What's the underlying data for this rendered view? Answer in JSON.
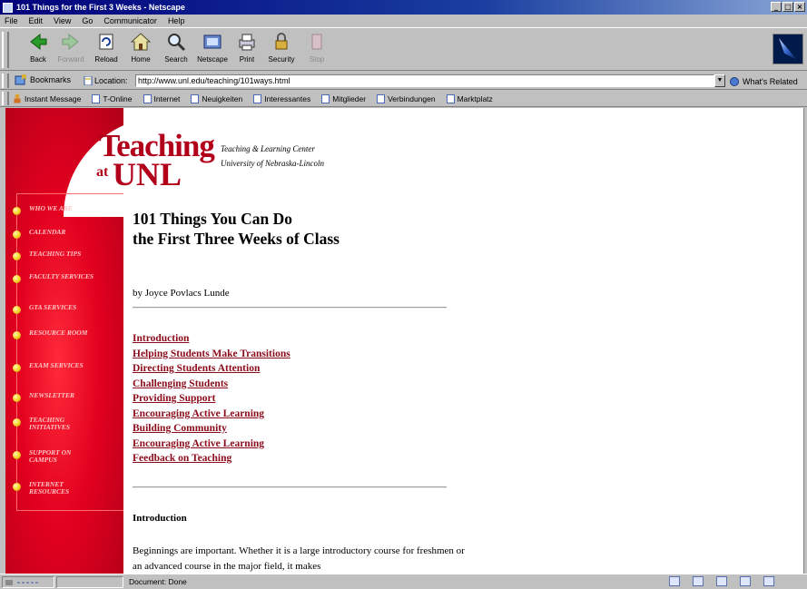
{
  "window": {
    "title": "101 Things for the First 3 Weeks - Netscape"
  },
  "menu": [
    "File",
    "Edit",
    "View",
    "Go",
    "Communicator",
    "Help"
  ],
  "toolbar": {
    "buttons": [
      {
        "label": "Back",
        "icon": "back-arrow-icon",
        "enabled": true
      },
      {
        "label": "Forward",
        "icon": "forward-arrow-icon",
        "enabled": false
      },
      {
        "label": "Reload",
        "icon": "reload-icon",
        "enabled": true
      },
      {
        "label": "Home",
        "icon": "home-icon",
        "enabled": true
      },
      {
        "label": "Search",
        "icon": "search-icon",
        "enabled": true
      },
      {
        "label": "Netscape",
        "icon": "netscape-icon",
        "enabled": true
      },
      {
        "label": "Print",
        "icon": "print-icon",
        "enabled": true
      },
      {
        "label": "Security",
        "icon": "security-lock-icon",
        "enabled": true
      },
      {
        "label": "Stop",
        "icon": "stop-icon",
        "enabled": false
      }
    ]
  },
  "location": {
    "bookmarks_label": "Bookmarks",
    "location_label": "Location:",
    "url": "http://www.unl.edu/teaching/101ways.html",
    "related_label": "What's Related"
  },
  "personal_toolbar": [
    "Instant Message",
    "T-Online",
    "Internet",
    "Neuigkeiten",
    "Interessantes",
    "Mitglieder",
    "Verbindungen",
    "Marktplatz"
  ],
  "page": {
    "logo": {
      "teaching": "Teaching",
      "at": "at",
      "unl": "UNL",
      "subtitle1": "Teaching & Learning Center",
      "subtitle2": "University of Nebraska-Lincoln"
    },
    "sidebar": [
      "Who We Are",
      "Calendar",
      "Teaching Tips",
      "Faculty Services",
      "GTA Services",
      "Resource Room",
      "Exam Services",
      "Newsletter",
      "Teaching Initiatives",
      "Support on Campus",
      "Internet Resources"
    ],
    "headline_line1": "101 Things You Can Do",
    "headline_line2": "the First Three Weeks of Class",
    "byline": "by Joyce Povlacs Lunde",
    "toc": [
      "Introduction",
      "Helping Students Make Transitions",
      "Directing Students Attention",
      "Challenging Students",
      "Providing Support",
      "Encouraging Active Learning",
      "Building Community",
      "Encouraging Active Learning",
      "Feedback on Teaching"
    ],
    "section_title": "Introduction",
    "paragraph": "Beginnings are important. Whether it is a large introductory course for freshmen or an advanced course in the major field, it makes"
  },
  "status": {
    "text": "Document: Done"
  },
  "colors": {
    "brand_red": "#b2001b",
    "link": "#8a0a1a",
    "sidebar_red": "#e2001f"
  }
}
